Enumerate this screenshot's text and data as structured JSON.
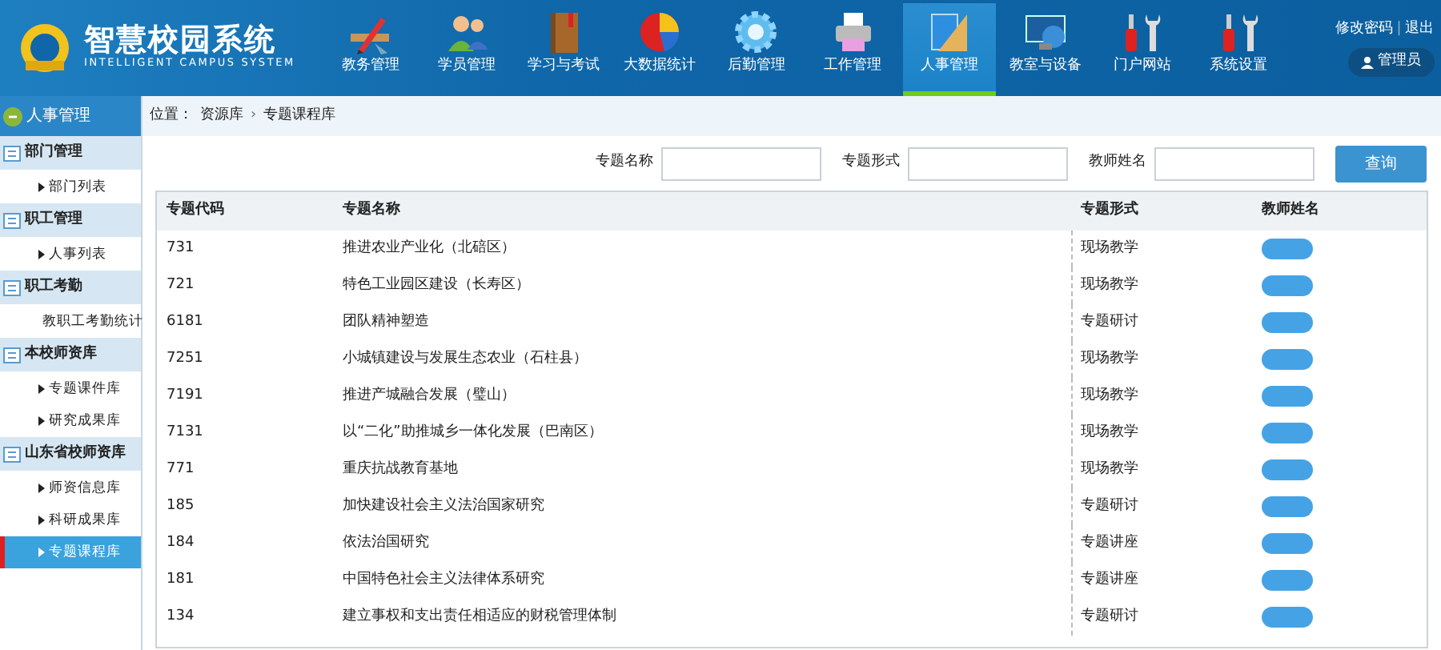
{
  "header": {
    "title": "智慧校园系统",
    "subtitle": "INTELLIGENT CAMPUS SYSTEM",
    "nav": [
      {
        "label": "教务管理",
        "selected": false
      },
      {
        "label": "学员管理",
        "selected": false
      },
      {
        "label": "学习与考试",
        "selected": false
      },
      {
        "label": "大数据统计",
        "selected": false
      },
      {
        "label": "后勤管理",
        "selected": false
      },
      {
        "label": "工作管理",
        "selected": false
      },
      {
        "label": "人事管理",
        "selected": true
      },
      {
        "label": "教室与设备",
        "selected": false
      },
      {
        "label": "门户网站",
        "selected": false
      },
      {
        "label": "系统设置",
        "selected": false
      }
    ],
    "links": [
      "修改密码",
      "退出"
    ],
    "link_separator": "|",
    "user": "管理员"
  },
  "sidebar": {
    "title": "人事管理",
    "groups": [
      {
        "label": "部门管理",
        "items": [
          {
            "label": "部门列表",
            "selected": false
          }
        ]
      },
      {
        "label": "职工管理",
        "items": [
          {
            "label": "人事列表",
            "selected": false
          }
        ]
      },
      {
        "label": "职工考勤",
        "items": [
          {
            "label": "教职工考勤统计",
            "selected": false
          }
        ]
      },
      {
        "label": "本校师资库",
        "items": [
          {
            "label": "专题课件库",
            "selected": false
          },
          {
            "label": "研究成果库",
            "selected": false
          }
        ]
      },
      {
        "label": "山东省校师资库",
        "items": [
          {
            "label": "师资信息库",
            "selected": false
          },
          {
            "label": "科研成果库",
            "selected": false
          },
          {
            "label": "专题课程库",
            "selected": true
          }
        ]
      }
    ]
  },
  "breadcrumb": [
    "位置：",
    "资源库",
    "专题课程库"
  ],
  "breadcrumb_separator": "›",
  "filters": [
    {
      "label": "专题名称"
    },
    {
      "label": "专题形式"
    },
    {
      "label": "教师姓名"
    }
  ],
  "search_button": "查询",
  "table": {
    "columns": [
      "专题代码",
      "专题名称",
      "专题形式",
      "教师姓名"
    ],
    "rows": [
      {
        "code": "731",
        "name": "推进农业产业化（北碚区）",
        "form": "现场教学",
        "teacher_hidden": true
      },
      {
        "code": "721",
        "name": "特色工业园区建设（长寿区）",
        "form": "现场教学",
        "teacher_hidden": true
      },
      {
        "code": "6181",
        "name": "团队精神塑造",
        "form": "专题研讨",
        "teacher_hidden": true
      },
      {
        "code": "7251",
        "name": "小城镇建设与发展生态农业（石柱县）",
        "form": "现场教学",
        "teacher_hidden": true
      },
      {
        "code": "7191",
        "name": "推进产城融合发展（璧山）",
        "form": "现场教学",
        "teacher_hidden": true
      },
      {
        "code": "7131",
        "name": "以“二化”助推城乡一体化发展（巴南区）",
        "form": "现场教学",
        "teacher_hidden": true
      },
      {
        "code": "771",
        "name": "重庆抗战教育基地",
        "form": "现场教学",
        "teacher_hidden": true
      },
      {
        "code": "185",
        "name": "加快建设社会主义法治国家研究",
        "form": "专题研讨",
        "teacher_hidden": true
      },
      {
        "code": "184",
        "name": "依法治国研究",
        "form": "专题讲座",
        "teacher_hidden": true
      },
      {
        "code": "181",
        "name": "中国特色社会主义法律体系研究",
        "form": "专题讲座",
        "teacher_hidden": true
      },
      {
        "code": "134",
        "name": "建立事权和支出责任相适应的财税管理体制",
        "form": "专题研讨",
        "teacher_hidden": true
      }
    ]
  }
}
